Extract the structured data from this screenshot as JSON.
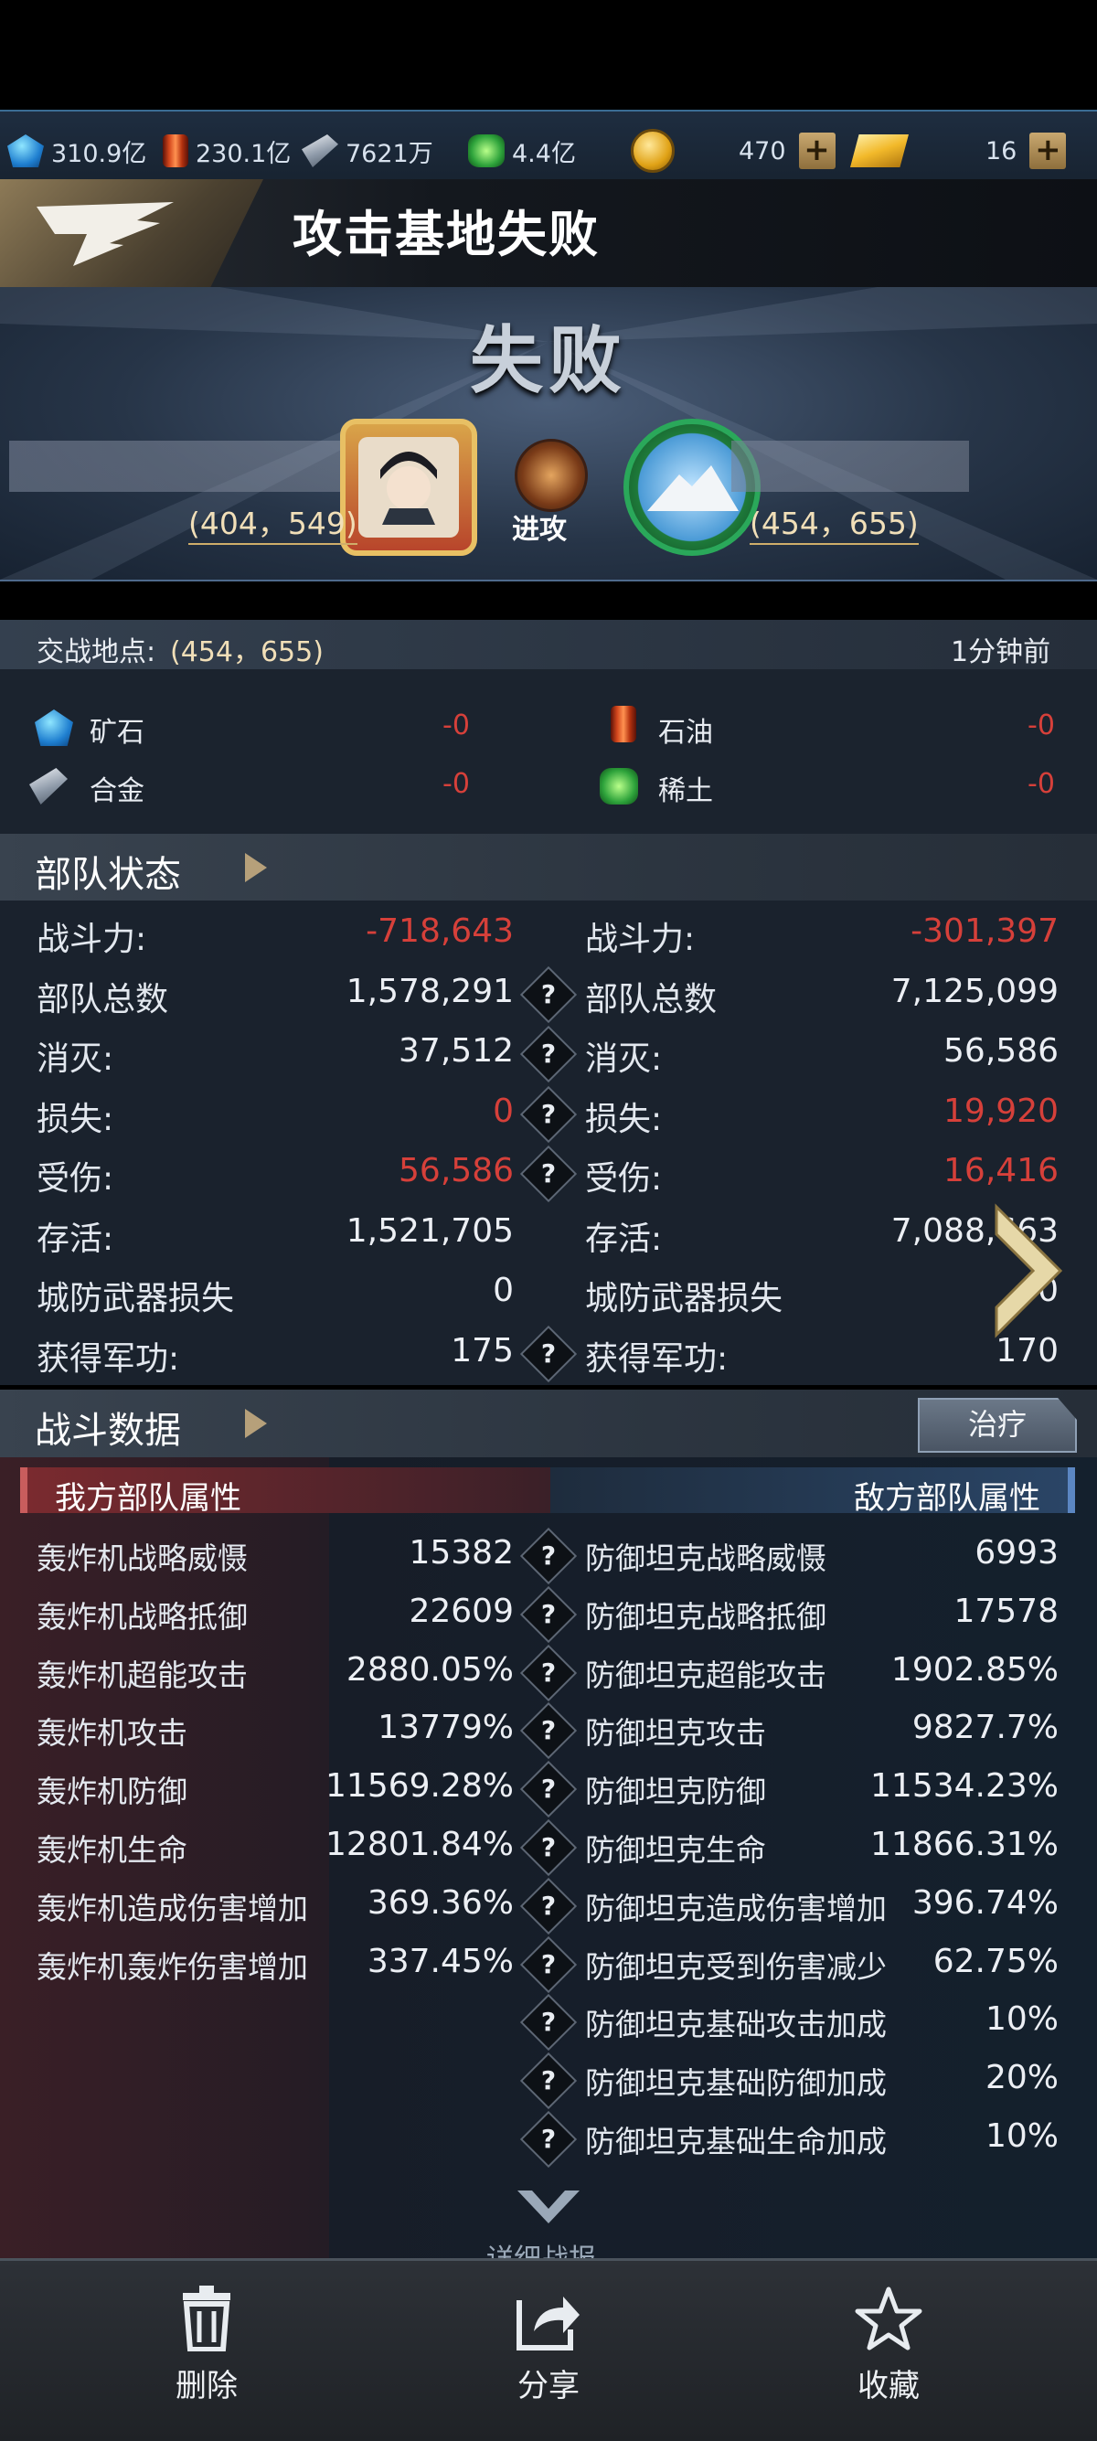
{
  "resources": {
    "ore": "310.9亿",
    "oil": "230.1亿",
    "alloy": "7621万",
    "rare_earth": "4.4亿",
    "coins": "470",
    "gold": "16"
  },
  "header": {
    "title": "攻击基地失败"
  },
  "result": {
    "status": "失败",
    "attacker_coord": "(404，549)",
    "defender_coord": "(454，655)",
    "action": "进攻"
  },
  "location": {
    "label": "交战地点:",
    "coord": "(454，655)",
    "time": "1分钟前"
  },
  "loot": [
    {
      "name": "矿石",
      "value": "-0",
      "icon": "ore-icon"
    },
    {
      "name": "石油",
      "value": "-0",
      "icon": "oil-icon"
    },
    {
      "name": "合金",
      "value": "-0",
      "icon": "alloy-icon"
    },
    {
      "name": "稀土",
      "value": "-0",
      "icon": "rare-earth-icon"
    }
  ],
  "troop_status": {
    "title": "部队状态",
    "rows": [
      {
        "label": "战斗力:",
        "left": "-718,643",
        "right": "-301,397",
        "left_neg": true,
        "right_neg": true,
        "help": false
      },
      {
        "label": "部队总数",
        "left": "1,578,291",
        "right": "7,125,099",
        "help": true
      },
      {
        "label": "消灭:",
        "left": "37,512",
        "right": "56,586",
        "help": true
      },
      {
        "label": "损失:",
        "left": "0",
        "right": "19,920",
        "left_neg": true,
        "right_neg": true,
        "help": true
      },
      {
        "label": "受伤:",
        "left": "56,586",
        "right": "16,416",
        "left_neg": true,
        "right_neg": true,
        "help": true
      },
      {
        "label": "存活:",
        "left": "1,521,705",
        "right": "7,088,663",
        "help": false
      },
      {
        "label": "城防武器损失",
        "left": "0",
        "right": "0",
        "help": false
      },
      {
        "label": "获得军功:",
        "left": "175",
        "right": "170",
        "help": true
      }
    ]
  },
  "battle_data": {
    "title": "战斗数据",
    "treat_button": "治疗",
    "my_header": "我方部队属性",
    "enemy_header": "敌方部队属性",
    "rows": [
      {
        "l": "轰炸机战略威慑",
        "lv": "15382",
        "r": "防御坦克战略威慑",
        "rv": "6993"
      },
      {
        "l": "轰炸机战略抵御",
        "lv": "22609",
        "r": "防御坦克战略抵御",
        "rv": "17578"
      },
      {
        "l": "轰炸机超能攻击",
        "lv": "2880.05%",
        "r": "防御坦克超能攻击",
        "rv": "1902.85%"
      },
      {
        "l": "轰炸机攻击",
        "lv": "13779%",
        "r": "防御坦克攻击",
        "rv": "9827.7%"
      },
      {
        "l": "轰炸机防御",
        "lv": "11569.28%",
        "r": "防御坦克防御",
        "rv": "11534.23%"
      },
      {
        "l": "轰炸机生命",
        "lv": "12801.84%",
        "r": "防御坦克生命",
        "rv": "11866.31%"
      },
      {
        "l": "轰炸机造成伤害增加",
        "lv": "369.36%",
        "r": "防御坦克造成伤害增加",
        "rv": "396.74%"
      },
      {
        "l": "轰炸机轰炸伤害增加",
        "lv": "337.45%",
        "r": "防御坦克受到伤害减少",
        "rv": "62.75%"
      },
      {
        "l": "",
        "lv": "",
        "r": "防御坦克基础攻击加成",
        "rv": "10%"
      },
      {
        "l": "",
        "lv": "",
        "r": "防御坦克基础防御加成",
        "rv": "20%"
      },
      {
        "l": "",
        "lv": "",
        "r": "防御坦克基础生命加成",
        "rv": "10%"
      }
    ],
    "details_label": "详细战报"
  },
  "toolbar": {
    "delete": "删除",
    "share": "分享",
    "favorite": "收藏"
  }
}
